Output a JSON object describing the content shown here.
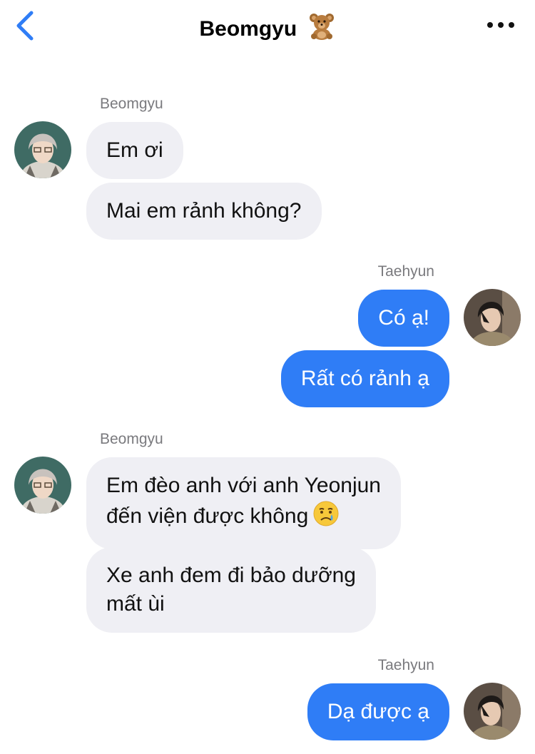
{
  "header": {
    "title": "Beomgyu",
    "title_emoji": "teddy-bear-icon",
    "back_icon": "chevron-left-icon",
    "more_icon": "more-horizontal-icon"
  },
  "colors": {
    "outgoing_bubble": "#2f7df6",
    "incoming_bubble": "#efeff4",
    "accent": "#2f7df6"
  },
  "messages": [
    {
      "sender": "Beomgyu",
      "direction": "incoming",
      "lines": [
        "Em ơi"
      ]
    },
    {
      "sender": "Beomgyu",
      "direction": "incoming",
      "lines": [
        "Mai em rảnh không?"
      ]
    },
    {
      "sender": "Taehyun",
      "direction": "outgoing",
      "lines": [
        "Có ạ!"
      ]
    },
    {
      "sender": "Taehyun",
      "direction": "outgoing",
      "lines": [
        "Rất có rảnh ạ"
      ]
    },
    {
      "sender": "Beomgyu",
      "direction": "incoming",
      "lines": [
        "Em đèo anh với anh Yeonjun",
        "đến viện được không"
      ],
      "emoji": "crying-face-icon"
    },
    {
      "sender": "Beomgyu",
      "direction": "incoming",
      "lines": [
        "Xe anh đem đi bảo dưỡng",
        "mất ùi"
      ]
    },
    {
      "sender": "Taehyun",
      "direction": "outgoing",
      "lines": [
        "Dạ được ạ"
      ]
    }
  ]
}
